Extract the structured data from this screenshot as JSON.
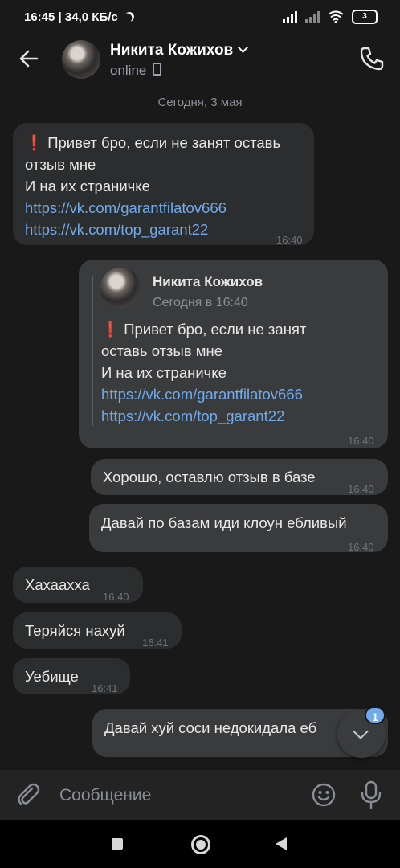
{
  "status_bar": {
    "time": "16:45",
    "speed": "34,0 КБ/с",
    "battery": "3"
  },
  "header": {
    "name": "Никита Кожихов",
    "status": "online"
  },
  "chat": {
    "date_separator": "Сегодня, 3 мая",
    "messages": [
      {
        "lines": [
          "Привет бро, если не занят оставь",
          "отзыв мне",
          "И на их страничке"
        ],
        "links": [
          "https://vk.com/garantfilatov666",
          "https://vk.com/top_garant22"
        ],
        "time": "16:40"
      },
      {
        "forward": {
          "author": "Никита Кожихов",
          "time": "Сегодня в 16:40",
          "lines": [
            "Привет бро, если не занят",
            "оставь отзыв мне",
            "И на их страничке"
          ],
          "links": [
            "https://vk.com/garantfilatov666",
            "https://vk.com/top_garant22"
          ]
        },
        "time": "16:40"
      },
      {
        "text": "Хорошо, оставлю отзыв в базе",
        "time": "16:40"
      },
      {
        "text": "Давай по базам иди клоун ебливый",
        "time": "16:40"
      },
      {
        "text": "Хахаахха",
        "time": "16:40"
      },
      {
        "text": "Теряйся нахуй",
        "time": "16:41"
      },
      {
        "text": "Уебище",
        "time": "16:41"
      },
      {
        "text": "Давай хуй соси недокидала еб",
        "time": ""
      }
    ],
    "unread_count": "1"
  },
  "composer": {
    "placeholder": "Сообщение"
  },
  "colors": {
    "background": "#19191a",
    "bubble_in": "#2c2d2e",
    "bubble_out": "#3a3b3d",
    "link": "#71aaeb",
    "accent_badge": "#71aaeb"
  },
  "icons": [
    "arrow-left-icon",
    "chevron-down-icon",
    "phone-icon",
    "paperclip-icon",
    "smile-icon",
    "mic-icon",
    "chevron-down-icon"
  ]
}
